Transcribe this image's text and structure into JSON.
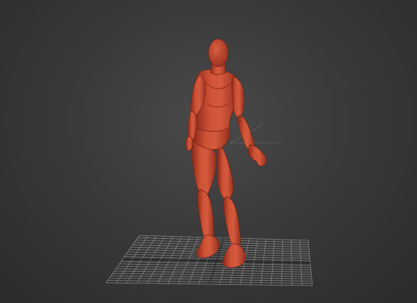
{
  "viewport": {
    "kind": "3D perspective viewport",
    "background_color": "#3a3a3a",
    "model_color": "#c84a32",
    "grid_color": "#9a9a9a"
  },
  "scene": {
    "objects": [
      {
        "kind": "mannequin",
        "color": "#c84a32"
      },
      {
        "kind": "ground-grid",
        "color": "#9a9a9a"
      }
    ]
  }
}
